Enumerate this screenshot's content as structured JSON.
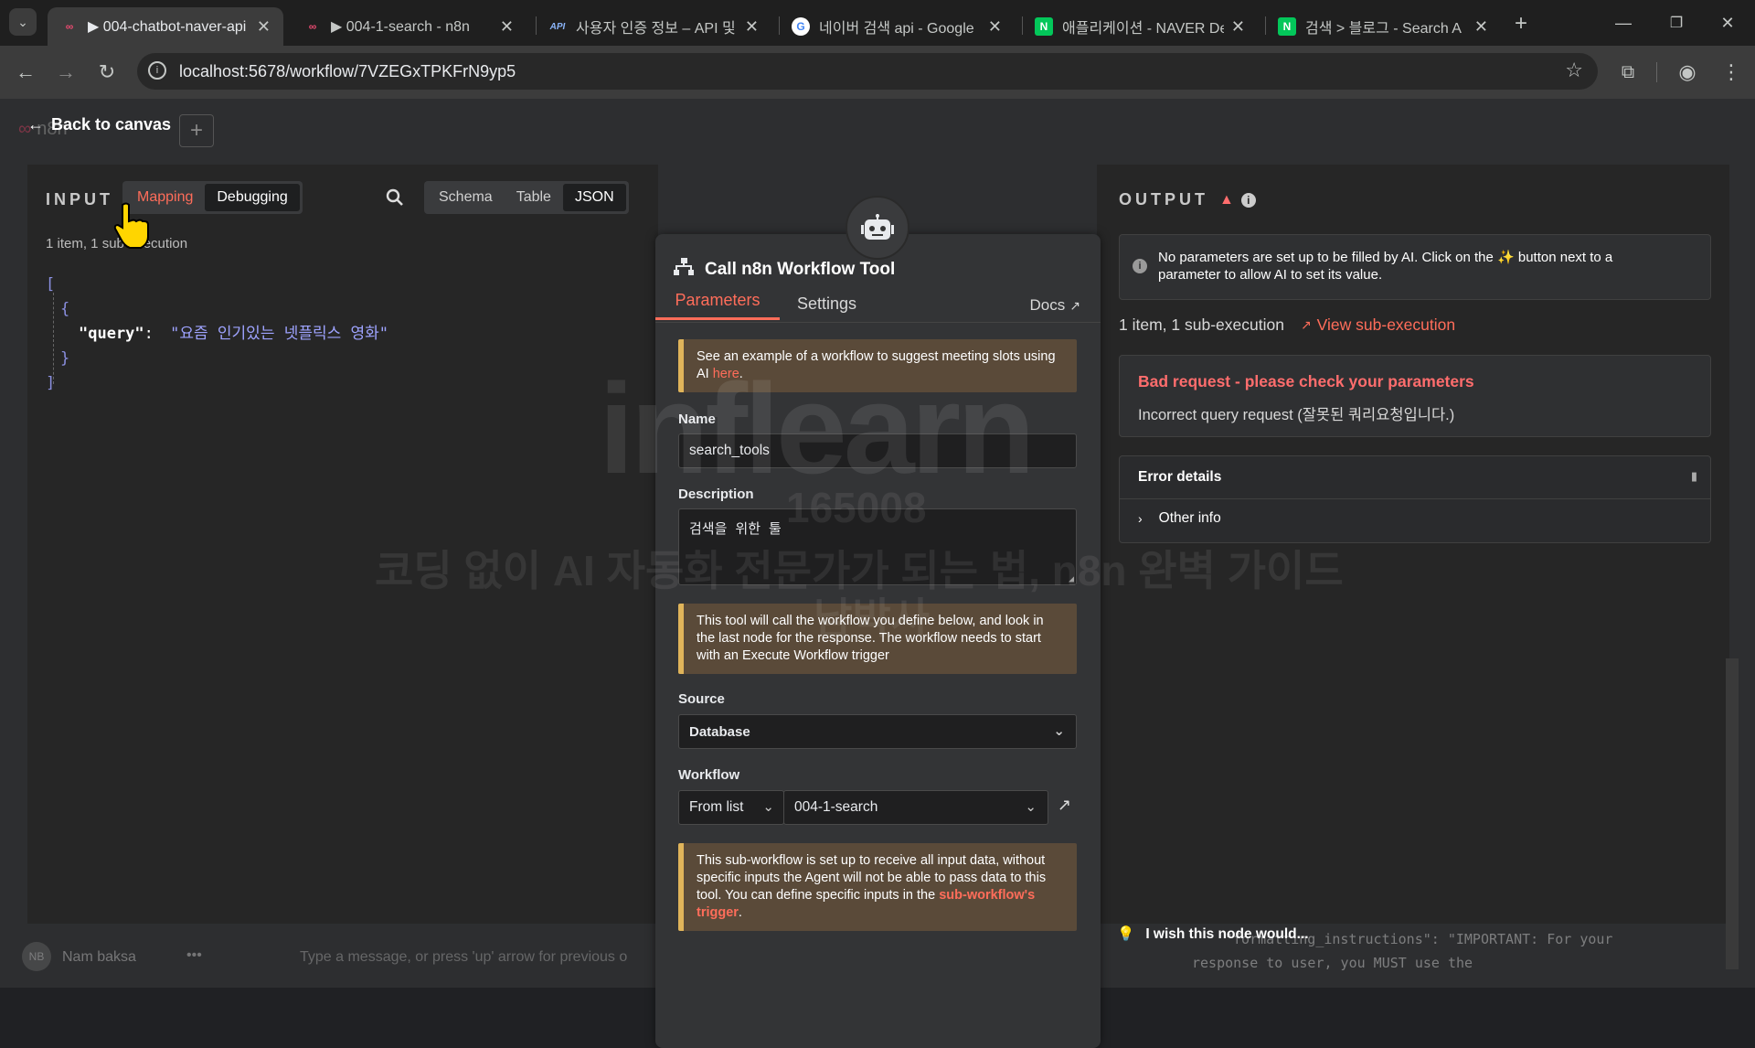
{
  "browser": {
    "tabs": [
      {
        "title": "▶ 004-chatbot-naver-api",
        "favicon": "n8n-icon",
        "active": true
      },
      {
        "title": "▶ 004-1-search - n8n",
        "favicon": "n8n-icon",
        "active": false
      },
      {
        "title": "사용자 인증 정보 – API 및",
        "favicon": "api-icon",
        "fav_text": "API",
        "active": false
      },
      {
        "title": "네이버 검색 api - Google",
        "favicon": "google-icon",
        "fav_text": "G",
        "active": false
      },
      {
        "title": "애플리케이션 - NAVER De",
        "favicon": "naver-icon",
        "fav_text": "N",
        "active": false
      },
      {
        "title": "검색 > 블로그 - Search A",
        "favicon": "naver-icon",
        "fav_text": "N",
        "active": false
      }
    ],
    "url": "localhost:5678/workflow/7VZEGxTPKFrN9yp5"
  },
  "header": {
    "back_label": "Back to canvas",
    "bg_logo_text": "n8n"
  },
  "input_panel": {
    "title": "INPUT",
    "modes": [
      "Mapping",
      "Debugging"
    ],
    "views": [
      "Schema",
      "Table",
      "JSON"
    ],
    "selected_view": "JSON",
    "summary": "1 item, 1 sub-execution",
    "json": {
      "open_bracket": "[",
      "open_brace": "{",
      "key": "\"query\"",
      "colon": ":",
      "value": "\"요즘 인기있는 넷플릭스 영화\"",
      "close_brace": "}",
      "close_bracket": "]"
    }
  },
  "node": {
    "title": "Call n8n Workflow Tool",
    "tabs": [
      "Parameters",
      "Settings"
    ],
    "active_tab": "Parameters",
    "docs_label": "Docs",
    "example_notice": {
      "text": "See an example of a workflow to suggest meeting slots using AI ",
      "link": "here",
      "end": "."
    },
    "name_label": "Name",
    "name_value": "search_tools",
    "description_label": "Description",
    "description_value": "검색을 위한 툴",
    "tool_notice": "This tool will call the workflow you define below, and look in the last node for the response. The workflow needs to start with an Execute Workflow trigger",
    "source_label": "Source",
    "source_value": "Database",
    "workflow_label": "Workflow",
    "workflow_mode": "From list",
    "workflow_value": "004-1-search",
    "sub_notice": {
      "text": "This sub-workflow is set up to receive all input data, without specific inputs the Agent will not be able to pass data to this tool. You can define specific inputs in the ",
      "link": "sub-workflow's trigger",
      "end": "."
    }
  },
  "output_panel": {
    "title": "OUTPUT",
    "info": "No parameters are set up to be filled by AI. Click on the ✨ button next to a parameter to allow AI to set its value.",
    "summary": "1 item, 1 sub-execution",
    "view_sub": "View sub-execution",
    "error_title": "Bad request - please check your parameters",
    "error_message": "Incorrect query request (잘못된 쿼리요청입니다.)",
    "error_details_label": "Error details",
    "other_info_label": "Other info",
    "feedback": "I wish this node would..."
  },
  "background": {
    "user_name": "Nam baksa",
    "user_initials": "NB",
    "chat_placeholder": "Type a message, or press 'up' arrow for previous o",
    "code_line1": "\"formatting_instructions\": \"IMPORTANT: For your",
    "code_line2": "response to user, you MUST use the"
  },
  "watermark": {
    "brand": "inflearn",
    "number": "165008",
    "line1": "코딩 없이 AI 자동화 전문가가 되는 법, n8n 완벽 가이드",
    "line2": "남박사"
  },
  "colors": {
    "accent": "#ff6d5a",
    "warning": "#e0b45a",
    "error": "#ff6d6d"
  }
}
